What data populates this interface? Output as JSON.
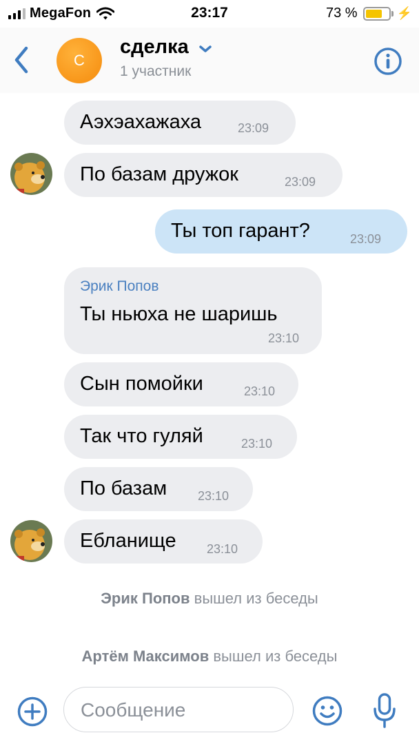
{
  "status_bar": {
    "carrier": "MegaFon",
    "time": "23:17",
    "battery": "73 %",
    "battery_level": 0.73
  },
  "header": {
    "back_icon": "chevron-left-icon",
    "avatar_letter": "С",
    "title": "сделка",
    "subtitle": "1 участник",
    "info_icon": "info-icon"
  },
  "messages": [
    {
      "text": "Аэхэахажаха",
      "time": "23:09"
    },
    {
      "text": "По базам дружок",
      "time": "23:09"
    },
    {
      "text": "Ты топ гарант?",
      "time": "23:09"
    },
    {
      "sender": "Эрик Попов",
      "text": "Ты ньюха не шаришь",
      "time": "23:10"
    },
    {
      "text": "Сын помойки",
      "time": "23:10"
    },
    {
      "text": "Так что гуляй",
      "time": "23:10"
    },
    {
      "text": "По базам",
      "time": "23:10"
    },
    {
      "text": "Ебланище",
      "time": "23:10"
    }
  ],
  "service_messages": [
    {
      "name": "Эрик Попов",
      "action": "вышел из беседы"
    },
    {
      "name": "Артём Максимов",
      "action": "вышел из беседы"
    }
  ],
  "composer": {
    "placeholder": "Сообщение"
  },
  "colors": {
    "accent": "#3f7cc0",
    "incoming_bubble": "#ecedf0",
    "outgoing_bubble": "#cce4f7",
    "avatar": "#f59a1b"
  }
}
